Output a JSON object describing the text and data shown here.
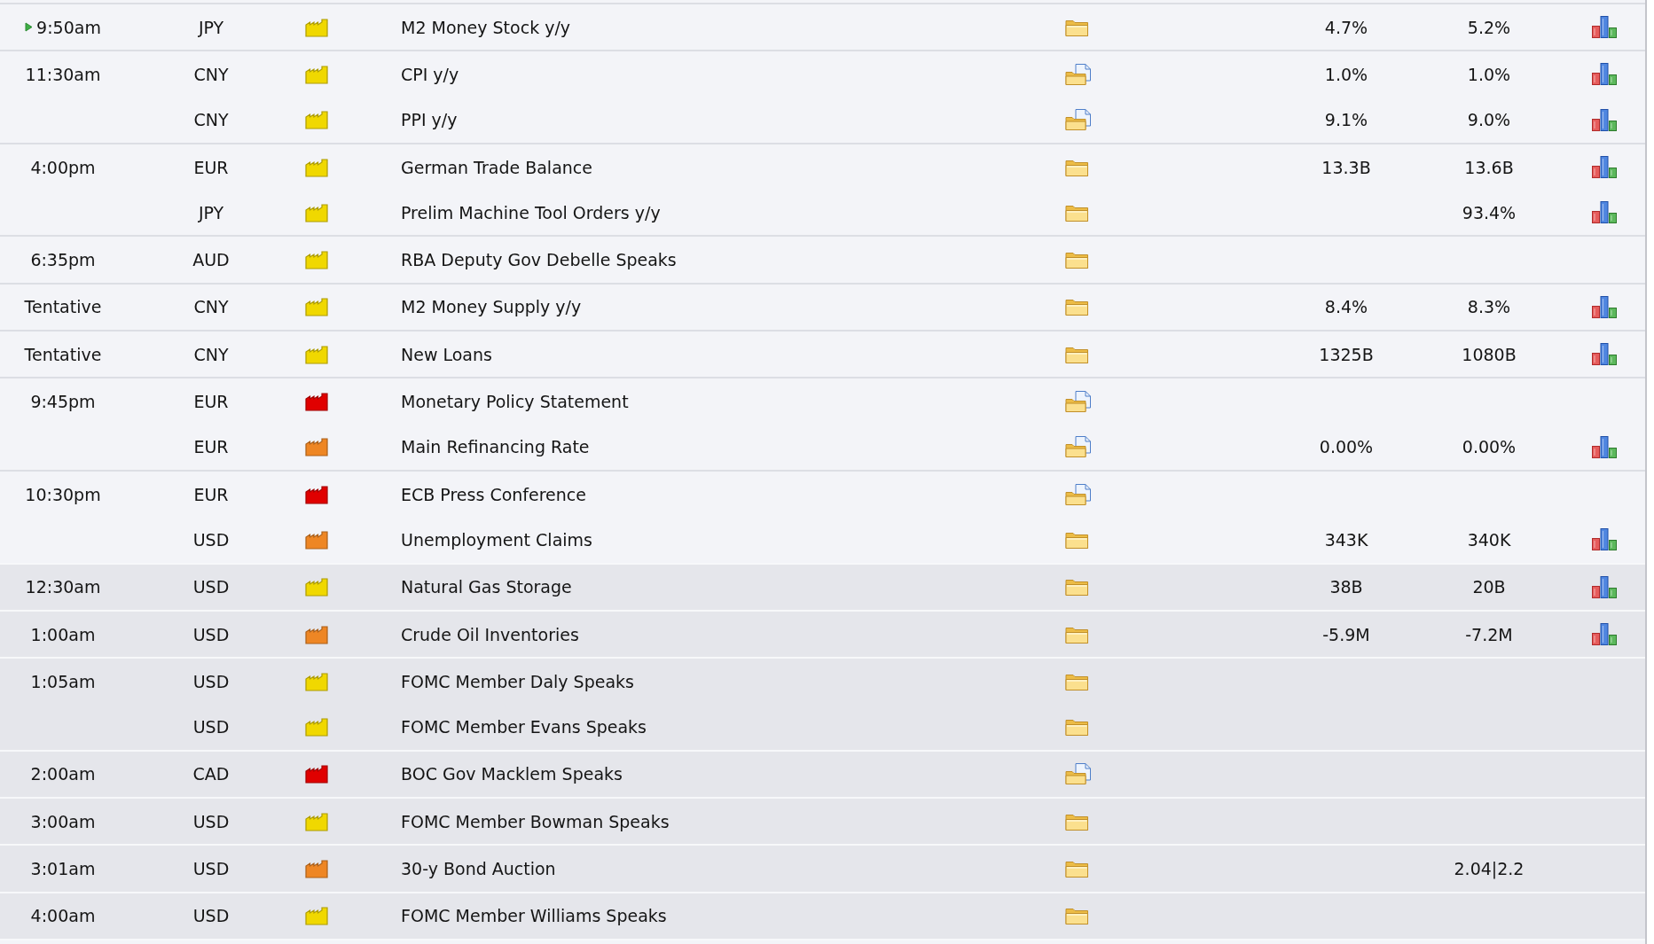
{
  "groups": [
    {
      "time": "9:50am",
      "next": true,
      "shaded": false,
      "events": [
        {
          "currency": "JPY",
          "color": "#f0d800",
          "event": "M2 Money Stock y/y",
          "page": false,
          "column_6": "4.7%",
          "column_7": "5.2%",
          "graph": true
        }
      ]
    },
    {
      "time": "11:30am",
      "next": false,
      "shaded": false,
      "events": [
        {
          "currency": "CNY",
          "color": "#f0d800",
          "event": "CPI y/y",
          "page": true,
          "column_6": "1.0%",
          "column_7": "1.0%",
          "graph": true
        },
        {
          "currency": "CNY",
          "color": "#f0d800",
          "event": "PPI y/y",
          "page": true,
          "column_6": "9.1%",
          "column_7": "9.0%",
          "graph": true
        }
      ]
    },
    {
      "time": "4:00pm",
      "next": false,
      "shaded": false,
      "events": [
        {
          "currency": "EUR",
          "color": "#f0d800",
          "event": "German Trade Balance",
          "page": false,
          "column_6": "13.3B",
          "column_7": "13.6B",
          "graph": true
        },
        {
          "currency": "JPY",
          "color": "#f0d800",
          "event": "Prelim Machine Tool Orders y/y",
          "page": false,
          "column_7": "93.4%",
          "graph": true
        }
      ]
    },
    {
      "time": "6:35pm",
      "next": false,
      "shaded": false,
      "events": [
        {
          "currency": "AUD",
          "color": "#f0d800",
          "event": "RBA Deputy Gov Debelle Speaks",
          "page": false,
          "graph": false
        }
      ]
    },
    {
      "time": "Tentative",
      "next": false,
      "shaded": false,
      "events": [
        {
          "currency": "CNY",
          "color": "#f0d800",
          "event": "M2 Money Supply y/y",
          "page": false,
          "column_6": "8.4%",
          "column_7": "8.3%",
          "graph": true
        }
      ]
    },
    {
      "time": "Tentative",
      "next": false,
      "shaded": false,
      "events": [
        {
          "currency": "CNY",
          "color": "#f0d800",
          "event": "New Loans",
          "page": false,
          "column_6": "1325B",
          "column_7": "1080B",
          "graph": true
        }
      ]
    },
    {
      "time": "9:45pm",
      "next": false,
      "shaded": false,
      "events": [
        {
          "currency": "EUR",
          "color": "#e00000",
          "event": "Monetary Policy Statement",
          "page": true,
          "graph": false
        },
        {
          "currency": "EUR",
          "color": "#ee8624",
          "event": "Main Refinancing Rate",
          "page": true,
          "column_6": "0.00%",
          "column_7": "0.00%",
          "graph": true
        }
      ]
    },
    {
      "time": "10:30pm",
      "next": false,
      "shaded": false,
      "events": [
        {
          "currency": "EUR",
          "color": "#e00000",
          "event": "ECB Press Conference",
          "page": true,
          "graph": false
        },
        {
          "currency": "USD",
          "color": "#ee8624",
          "event": "Unemployment Claims",
          "page": false,
          "column_6": "343K",
          "column_7": "340K",
          "graph": true
        }
      ]
    },
    {
      "time": "12:30am",
      "next": false,
      "shaded": true,
      "events": [
        {
          "currency": "USD",
          "color": "#f0d800",
          "event": "Natural Gas Storage",
          "page": false,
          "column_6": "38B",
          "column_7": "20B",
          "graph": true
        }
      ]
    },
    {
      "time": "1:00am",
      "next": false,
      "shaded": true,
      "events": [
        {
          "currency": "USD",
          "color": "#ee8624",
          "event": "Crude Oil Inventories",
          "page": false,
          "column_6": "-5.9M",
          "column_7": "-7.2M",
          "graph": true
        }
      ]
    },
    {
      "time": "1:05am",
      "next": false,
      "shaded": true,
      "events": [
        {
          "currency": "USD",
          "color": "#f0d800",
          "event": "FOMC Member Daly Speaks",
          "page": false,
          "graph": false
        },
        {
          "currency": "USD",
          "color": "#f0d800",
          "event": "FOMC Member Evans Speaks",
          "page": false,
          "graph": false
        }
      ]
    },
    {
      "time": "2:00am",
      "next": false,
      "shaded": true,
      "events": [
        {
          "currency": "CAD",
          "color": "#e00000",
          "event": "BOC Gov Macklem Speaks",
          "page": true,
          "graph": false
        }
      ]
    },
    {
      "time": "3:00am",
      "next": false,
      "shaded": true,
      "events": [
        {
          "currency": "USD",
          "color": "#f0d800",
          "event": "FOMC Member Bowman Speaks",
          "page": false,
          "graph": false
        }
      ]
    },
    {
      "time": "3:01am",
      "next": false,
      "shaded": true,
      "events": [
        {
          "currency": "USD",
          "color": "#ee8624",
          "event": "30-y Bond Auction",
          "page": false,
          "column_7": "2.04|2.2",
          "graph": false
        }
      ]
    },
    {
      "time": "4:00am",
      "next": false,
      "shaded": true,
      "events": [
        {
          "currency": "USD",
          "color": "#f0d800",
          "event": "FOMC Member Williams Speaks",
          "page": false,
          "graph": false
        }
      ]
    }
  ]
}
